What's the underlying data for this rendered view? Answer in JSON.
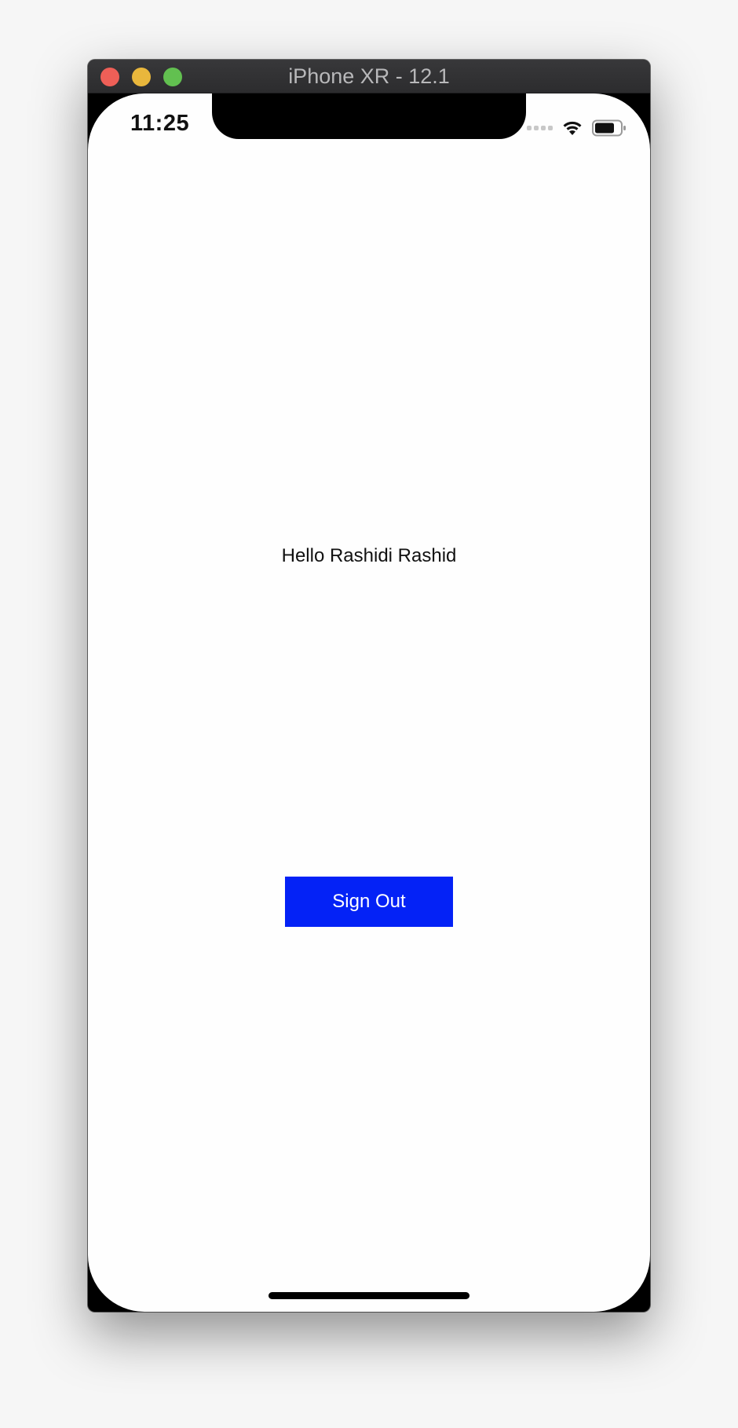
{
  "window": {
    "title": "iPhone XR - 12.1",
    "buttons": {
      "close": "close-button",
      "minimize": "minimize-button",
      "zoom": "zoom-button"
    }
  },
  "status_bar": {
    "time": "11:25",
    "icons": [
      "cellular-signal-icon",
      "wifi-icon",
      "battery-icon"
    ]
  },
  "main": {
    "greeting": "Hello Rashidi Rashid",
    "sign_out_label": "Sign Out"
  },
  "colors": {
    "button_background": "#0422f6",
    "button_text": "#ffffff",
    "screen_background": "#fefefe"
  }
}
